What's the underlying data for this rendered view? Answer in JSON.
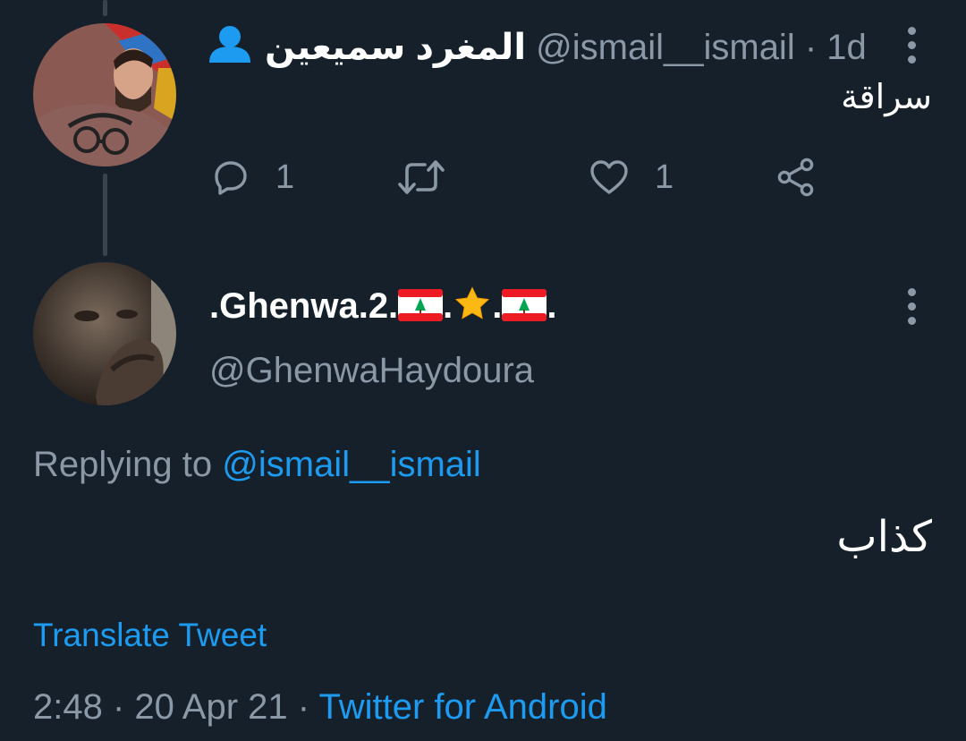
{
  "tweet1": {
    "display_name": "المغرد سميعين",
    "handle": "@ismail__ismail",
    "separator": "·",
    "time": "1d",
    "text": "سراقة",
    "reply_count": "1",
    "like_count": "1",
    "icons": {
      "reply": "reply-icon",
      "retweet": "retweet-icon",
      "like": "heart-icon",
      "share": "share-icon",
      "more": "more-icon",
      "profile": "person-icon"
    }
  },
  "tweet2": {
    "display_name_parts": [
      ".Ghenwa.2.",
      ".",
      ".",
      "."
    ],
    "emoji": [
      "lebanon-flag",
      "star",
      "lebanon-flag"
    ],
    "handle": "@GhenwaHaydoura",
    "replying_label": "Replying to",
    "replying_handle": "@ismail__ismail",
    "text": "كذاب",
    "translate_label": "Translate Tweet",
    "timestamp": "2:48 · 20 Apr 21 · ",
    "source": "Twitter for Android"
  },
  "colors": {
    "background": "#15202b",
    "text": "#ffffff",
    "muted": "#8b98a5",
    "link": "#1d9bf0",
    "thread_line": "#38444d",
    "profile_icon": "#1d9bf0"
  }
}
